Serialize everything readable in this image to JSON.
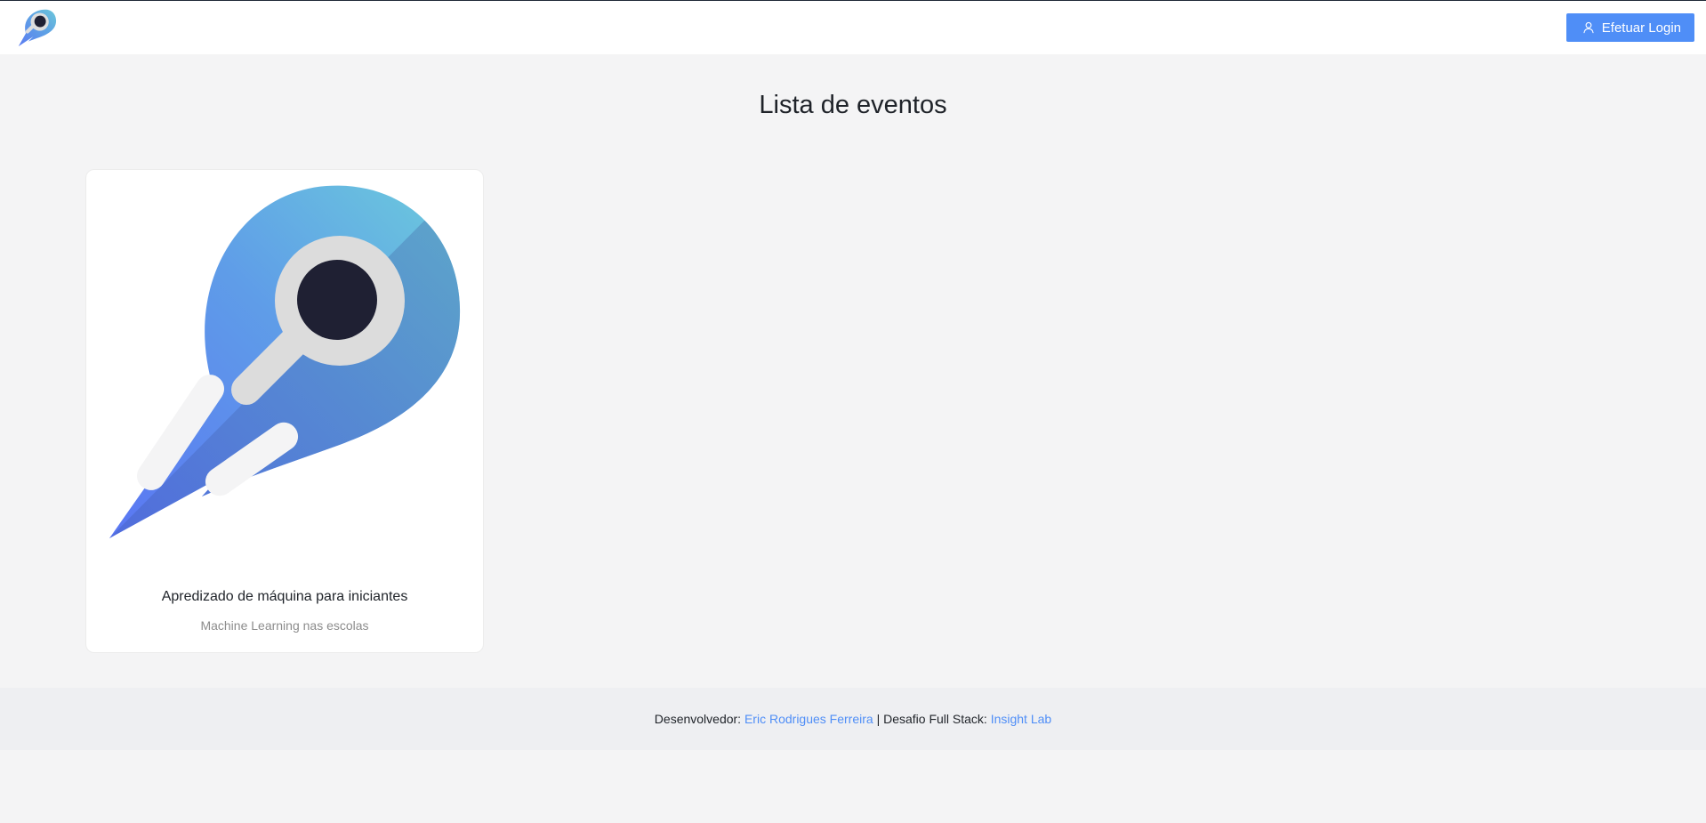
{
  "header": {
    "logo_icon": "rocket-magnifier-logo",
    "login_label": "Efetuar Login",
    "login_icon": "user-icon"
  },
  "main": {
    "title": "Lista de eventos",
    "events": [
      {
        "title": "Apredizado de máquina para iniciantes",
        "subtitle": "Machine Learning nas escolas",
        "image_icon": "rocket-magnifier-logo"
      }
    ]
  },
  "footer": {
    "developer_prefix": "Desenvolvedor: ",
    "developer_name": "Eric Rodrigues Ferreira",
    "separator": " | Desafio Full Stack: ",
    "org_name": "Insight Lab"
  },
  "colors": {
    "accent": "#4f8ef7",
    "page_bg": "#f4f4f5",
    "footer_bg": "#eeeff2",
    "logo_blue": "#5b8ef0",
    "logo_teal": "#6cc3d8",
    "logo_dark": "#1f2033"
  }
}
